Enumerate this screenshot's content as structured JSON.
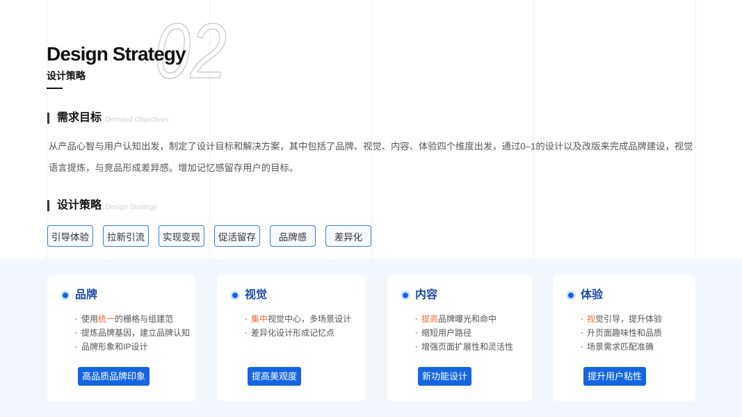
{
  "header": {
    "title_en": "Design Strategy",
    "title_cn": "设计策略",
    "section_number": "02"
  },
  "demand": {
    "title": "需求目标",
    "subtitle": "Demand Objectives",
    "paragraph": "从产品心智与用户认知出发，制定了设计目标和解决方案，其中包括了品牌、视觉、内容、体验四个维度出发，通过0–1的设计以及改版来完成品牌建设，视觉语言提炼，与竞品形成差异感。增加记忆感留存用户的目标。"
  },
  "strategy": {
    "title": "设计策略",
    "subtitle": "Design Strategy",
    "tags": [
      "引导体验",
      "拉新引流",
      "实现变现",
      "促活留存",
      "品牌感",
      "差异化"
    ]
  },
  "cards": [
    {
      "title": "品牌",
      "bullets": [
        {
          "pre": "使用",
          "highlight": "统一",
          "post": "的栅格与组建范"
        },
        {
          "text": "提炼品牌基因，建立品牌认知"
        },
        {
          "text": "品牌形象和IP设计"
        }
      ],
      "button": "高品质品牌印象"
    },
    {
      "title": "视觉",
      "bullets": [
        {
          "highlight": "集中",
          "post": "视觉中心，多场景设计"
        },
        {
          "text": "差异化设计形成记忆点"
        }
      ],
      "button": "提高美观度"
    },
    {
      "title": "内容",
      "bullets": [
        {
          "highlight": "提高",
          "post": "品牌曝光和命中"
        },
        {
          "text": "缩短用户路径"
        },
        {
          "text": "增强页面扩展性和灵活性"
        }
      ],
      "button": "新功能设计"
    },
    {
      "title": "体验",
      "bullets": [
        {
          "highlight": "视",
          "post": "觉引导，提升体验"
        },
        {
          "text": "升页面趣味性和品质"
        },
        {
          "text": "场景需求匹配准确"
        }
      ],
      "button": "提升用户粘性"
    }
  ],
  "icons": {
    "card_marker": "bullet-dot-icon"
  },
  "colors": {
    "accent": "#1565e0",
    "title_blue": "#1e4aa3",
    "highlight": "#f26b3a",
    "panel_bg": "#f2f6fd",
    "tag_border": "#3c7ae6"
  }
}
